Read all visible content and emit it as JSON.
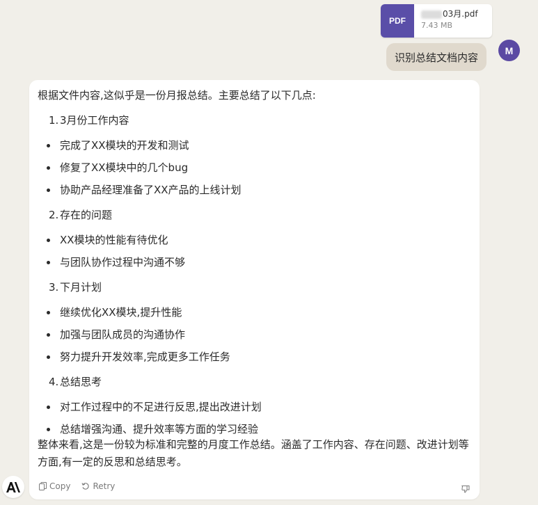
{
  "attachment": {
    "badge": "PDF",
    "filename_visible": "03月.pdf",
    "size": "7.43 MB"
  },
  "user_message": {
    "text": "识别总结文档内容",
    "avatar_initial": "M"
  },
  "assistant": {
    "intro": "根据文件内容,这似乎是一份月报总结。主要总结了以下几点:",
    "sections": [
      {
        "number": "1.",
        "title": "3月份工作内容",
        "bullets": [
          "完成了XX模块的开发和测试",
          "修复了XX模块中的几个bug",
          "协助产品经理准备了XX产品的上线计划"
        ]
      },
      {
        "number": "2.",
        "title": "存在的问题",
        "bullets": [
          "XX模块的性能有待优化",
          "与团队协作过程中沟通不够"
        ]
      },
      {
        "number": "3.",
        "title": "下月计划",
        "bullets": [
          "继续优化XX模块,提升性能",
          "加强与团队成员的沟通协作",
          "努力提升开发效率,完成更多工作任务"
        ]
      },
      {
        "number": "4.",
        "title": "总结思考",
        "bullets": [
          "对工作过程中的不足进行反思,提出改进计划",
          "总结增强沟通、提升效率等方面的学习经验"
        ]
      }
    ],
    "summary": "整体来看,这是一份较为标准和完整的月度工作总结。涵盖了工作内容、存在问题、改进计划等方面,有一定的反思和总结思考。",
    "actions": {
      "copy": "Copy",
      "retry": "Retry"
    }
  },
  "colors": {
    "background": "#f1efe9",
    "pdf_badge": "#5a4ea8",
    "user_bubble": "#e0d9cd",
    "avatar": "#5b4aa3"
  },
  "icons": [
    "document-icon",
    "copy-icon",
    "retry-icon",
    "thumbs-down-icon",
    "anthropic-logo"
  ]
}
